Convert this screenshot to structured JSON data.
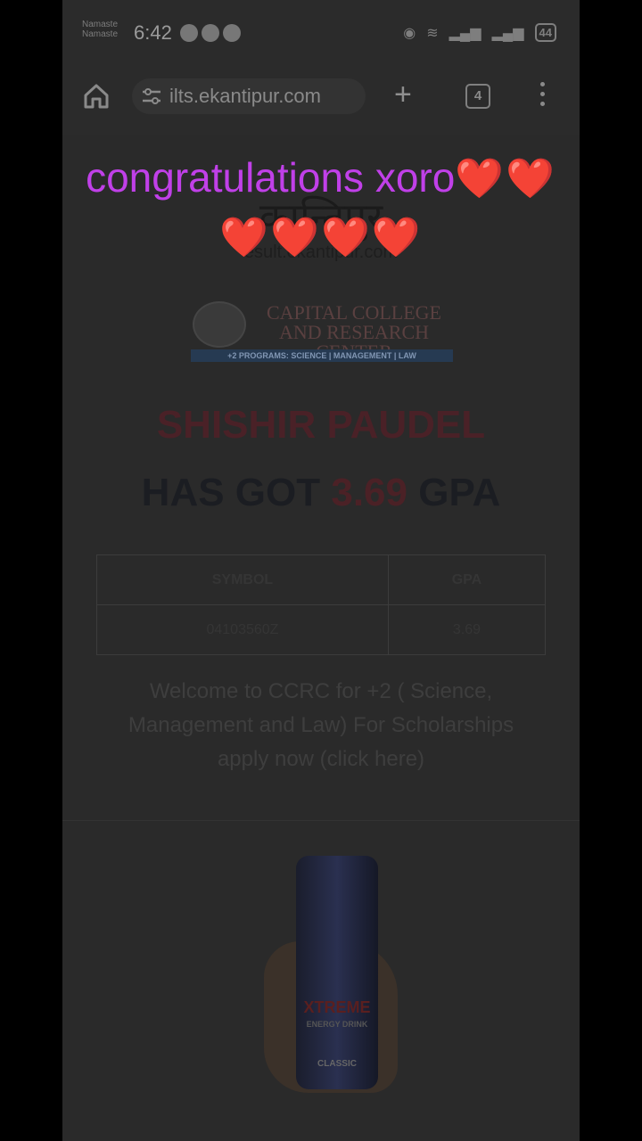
{
  "status_bar": {
    "carrier_line1": "Namaste",
    "carrier_line2": "Namaste",
    "time": "6:42",
    "battery": "44"
  },
  "browser": {
    "url": "ilts.ekantipur.com",
    "tab_count": "4",
    "plus_label": "+"
  },
  "page": {
    "site_name": "esult.ekantipur.com",
    "college_name": "CAPITAL COLLEGE AND RESEARCH CENTER",
    "programs": "+2 PROGRAMS: SCIENCE | MANAGEMENT | LAW",
    "student_name": "SHISHIR PAUDEL",
    "has_got": "HAS GOT",
    "gpa_value": "3.69",
    "gpa_suffix": "GPA",
    "table": {
      "headers": [
        "SYMBOL",
        "GPA"
      ],
      "rows": [
        [
          "04103560Z",
          "3.69"
        ]
      ]
    },
    "welcome_text": "Welcome to CCRC for +2 ( Science, Management and Law) For Scholarships apply now (",
    "click_here": "click here",
    "welcome_close": ")",
    "ad": {
      "brand": "XTREME",
      "sub": "ENERGY DRINK",
      "variant": "CLASSIC"
    }
  },
  "caption": {
    "text": "congratulations xoro",
    "hearts_line1": "❤️❤️",
    "hearts_line2": "❤️❤️❤️❤️"
  }
}
